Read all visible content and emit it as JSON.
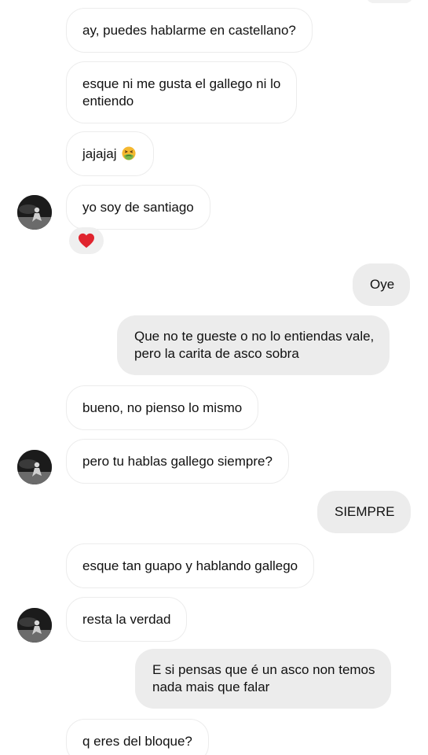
{
  "thread": {
    "messages": [
      {
        "side": "in",
        "text": "ay, puedes hablarme en castellano?"
      },
      {
        "side": "in",
        "lines": [
          "esque ni me gusta el gallego ni lo",
          "entiendo"
        ]
      },
      {
        "side": "in",
        "text": "jajajaj",
        "emoji": "nauseated-face-icon"
      },
      {
        "side": "in",
        "text": "yo soy de santiago",
        "reaction": "red-heart-icon"
      },
      {
        "side": "out",
        "text": "Oye"
      },
      {
        "side": "out",
        "lines": [
          "Que no te gueste o no lo entiendas vale,",
          "pero la carita de asco sobra"
        ]
      },
      {
        "side": "in",
        "text": "bueno, no pienso lo mismo"
      },
      {
        "side": "in",
        "text": "pero tu hablas gallego siempre?"
      },
      {
        "side": "out",
        "text": "SIEMPRE"
      },
      {
        "side": "in",
        "text": "esque tan guapo y hablando gallego"
      },
      {
        "side": "in",
        "text": "resta la verdad"
      },
      {
        "side": "out",
        "lines": [
          "E si pensas que é un asco non temos",
          "nada mais que falar"
        ]
      },
      {
        "side": "in",
        "text": "q eres del bloque?"
      }
    ]
  },
  "colors": {
    "incoming_bubble": "#ffffff",
    "incoming_border": "#ececec",
    "outgoing_bubble": "#ececec",
    "text": "#111111",
    "heart": "#e0242e",
    "avatar_bg": "#1b1b1b"
  },
  "icons": {
    "avatar": "avatar-photo-icon",
    "reaction": "red-heart-icon",
    "emoji": "nauseated-face-icon"
  }
}
